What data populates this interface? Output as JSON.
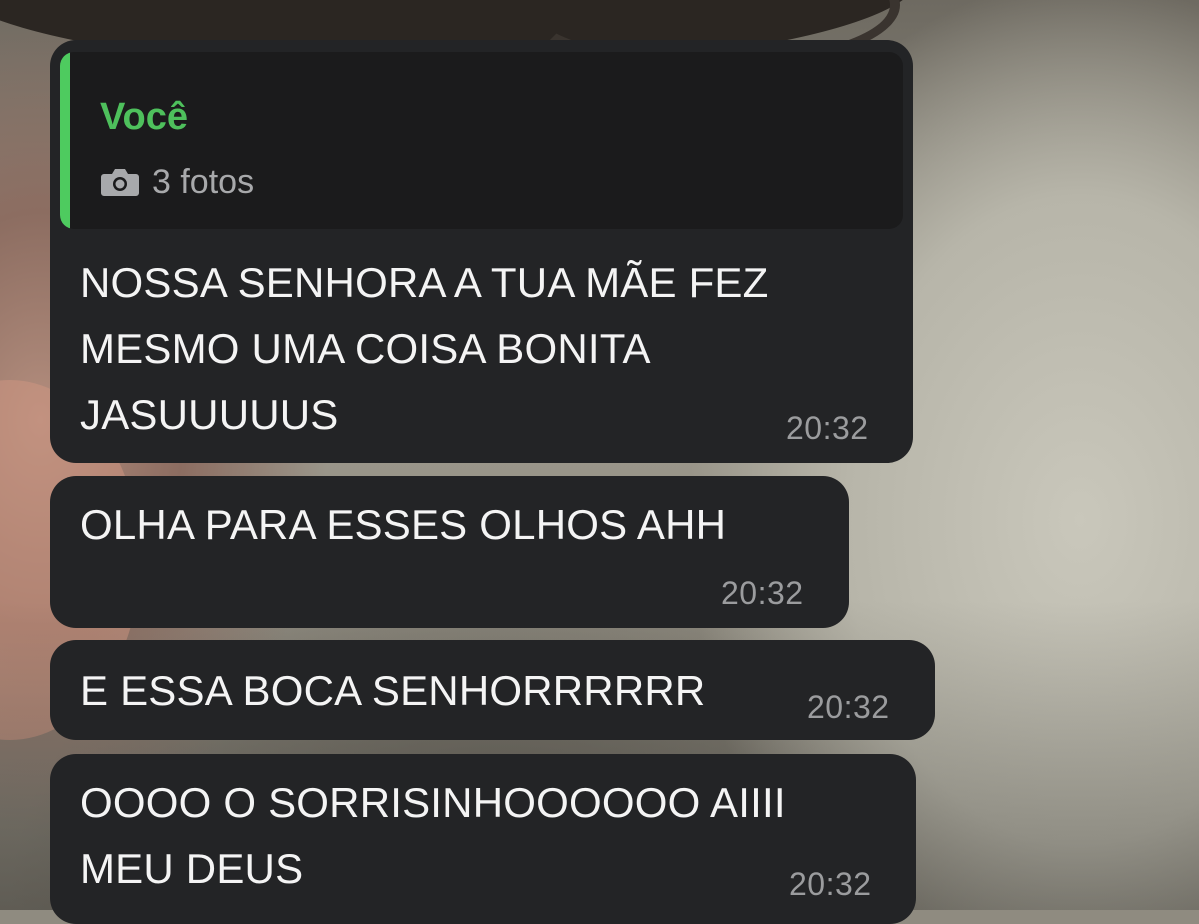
{
  "colors": {
    "bubble_bg": "#232426",
    "quote_bg": "#1b1b1c",
    "quote_accent": "#4ecb5f",
    "text": "#f4f4f4",
    "time": "#9b9c9e"
  },
  "messages": [
    {
      "reply": {
        "author": "Você",
        "icon": "camera-icon",
        "text": "3 fotos"
      },
      "text": "NOSSA SENHORA A TUA MÃE FEZ\nMESMO UMA COISA BONITA\nJASUUUUUS",
      "time": "20:32"
    },
    {
      "text": "OLHA PARA ESSES OLHOS AHH",
      "time": "20:32"
    },
    {
      "text": "E ESSA BOCA SENHORRRRRR",
      "time": "20:32"
    },
    {
      "text": "OOOO O SORRISINHOOOOOO AIIII\nMEU DEUS",
      "time": "20:32"
    }
  ]
}
